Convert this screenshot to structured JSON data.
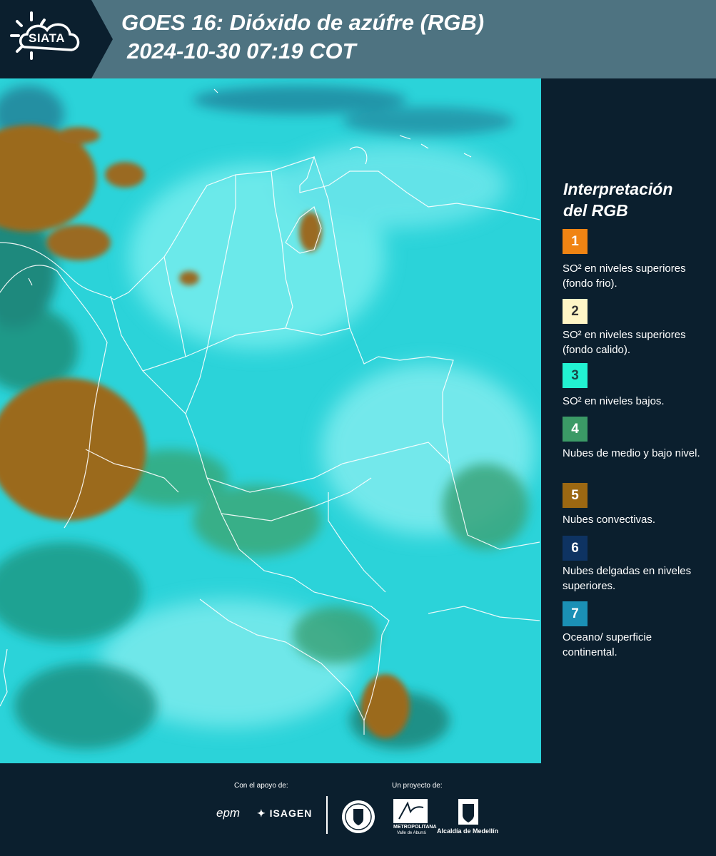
{
  "header": {
    "logo_text": "SIATA",
    "title_line1": "GOES 16: Dióxido de azúfre (RGB)",
    "title_line2": "2024-10-30 07:19 COT"
  },
  "legend": {
    "title_line1": "Interpretación",
    "title_line2": "del RGB",
    "items": [
      {
        "number": "1",
        "color": "#f08413",
        "text_color": "#ffffff",
        "description": "SO² en niveles superiores (fondo frio)."
      },
      {
        "number": "2",
        "color": "#fff6c6",
        "text_color": "#333333",
        "description": "SO² en niveles superiores (fondo calido)."
      },
      {
        "number": "3",
        "color": "#22f2d2",
        "text_color": "#1a4a48",
        "description": "SO² en niveles bajos."
      },
      {
        "number": "4",
        "color": "#3b9a66",
        "text_color": "#ffffff",
        "description": "Nubes de medio y bajo nivel."
      },
      {
        "number": "5",
        "color": "#9c6812",
        "text_color": "#ffffff",
        "description": "Nubes convectivas."
      },
      {
        "number": "6",
        "color": "#0e3362",
        "text_color": "#ffffff",
        "description": "Nubes delgadas en niveles superiores."
      },
      {
        "number": "7",
        "color": "#1b90b5",
        "text_color": "#ffffff",
        "description": "Oceano/ superficie continental."
      }
    ]
  },
  "footer": {
    "support_label": "Con el apoyo de:",
    "project_label": "Un proyecto de:",
    "sponsor_epm": "epm",
    "sponsor_isagen": "ISAGEN",
    "area_caption_1": "METROPOLITANA",
    "area_caption_2": "Valle de Aburrá",
    "alcaldia_caption": "Alcaldía de Medellín"
  }
}
